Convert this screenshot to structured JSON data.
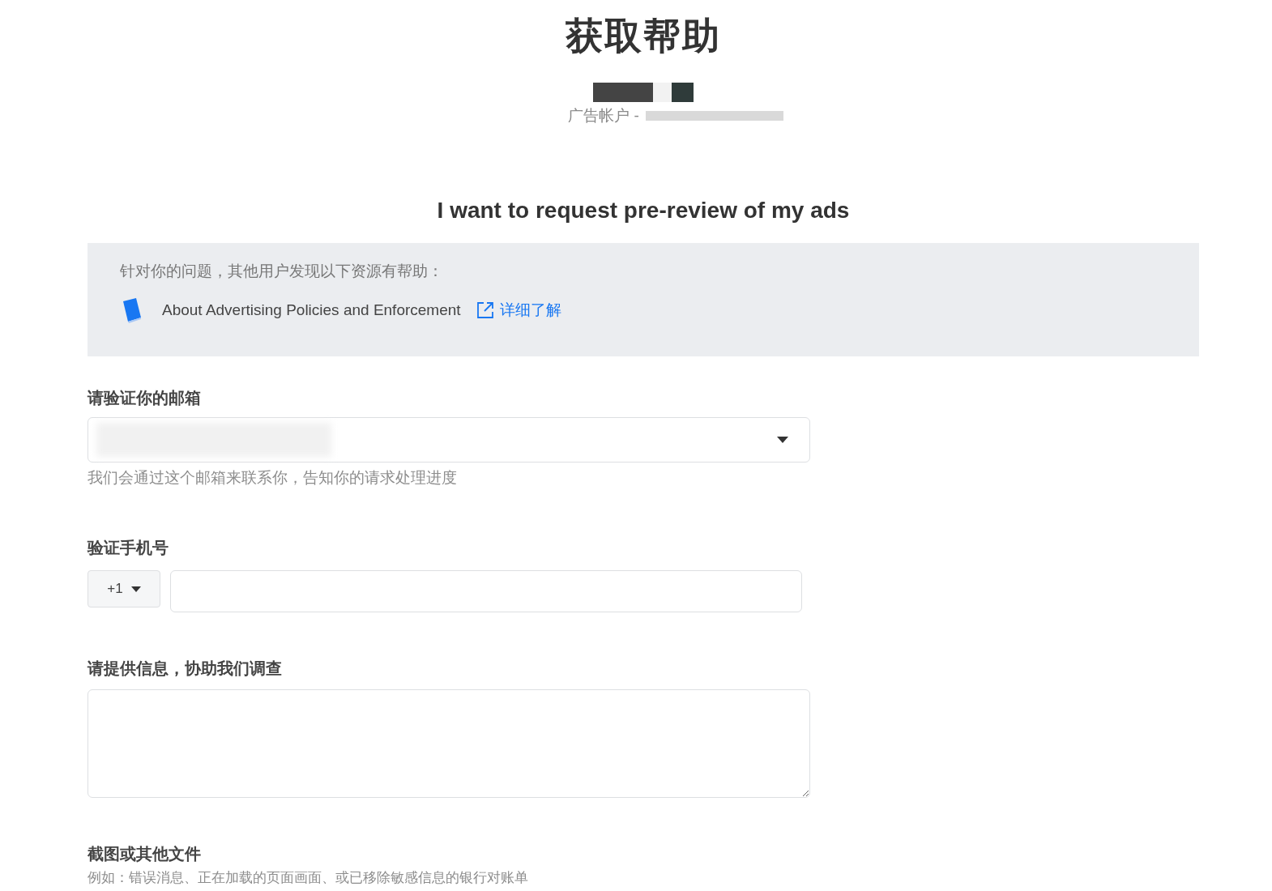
{
  "title": "获取帮助",
  "account": {
    "label": "广告帐户 -"
  },
  "request_heading": "I want to request pre-review of my ads",
  "resources": {
    "intro": "针对你的问题，其他用户发现以下资源有帮助：",
    "items": [
      {
        "title": "About Advertising Policies and Enforcement",
        "link": "详细了解"
      }
    ]
  },
  "email": {
    "label": "请验证你的邮箱",
    "hint": "我们会通过这个邮箱来联系你，告知你的请求处理进度"
  },
  "phone": {
    "label": "验证手机号",
    "country_code": "+1"
  },
  "details": {
    "label": "请提供信息，协助我们调查"
  },
  "attachments": {
    "label": "截图或其他文件",
    "hint": "例如：错误消息、正在加载的页面画面、或已移除敏感信息的银行对账单"
  }
}
